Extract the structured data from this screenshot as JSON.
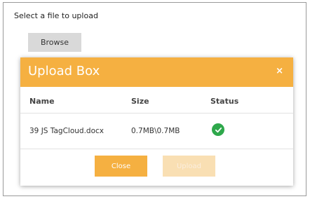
{
  "page": {
    "prompt": "Select a file to upload",
    "browse_label": "Browse"
  },
  "dialog": {
    "title": "Upload Box",
    "close_icon": "×",
    "columns": [
      "Name",
      "Size",
      "Status"
    ],
    "files": [
      {
        "name": "39 JS TagCloud.docx",
        "size": "0.7MB\\0.7MB",
        "status": "complete"
      }
    ],
    "buttons": {
      "close": "Close",
      "upload": "Upload"
    }
  },
  "colors": {
    "accent": "#f5b041",
    "success": "#2ea84b",
    "upload_disabled": "#f9dfb3"
  }
}
